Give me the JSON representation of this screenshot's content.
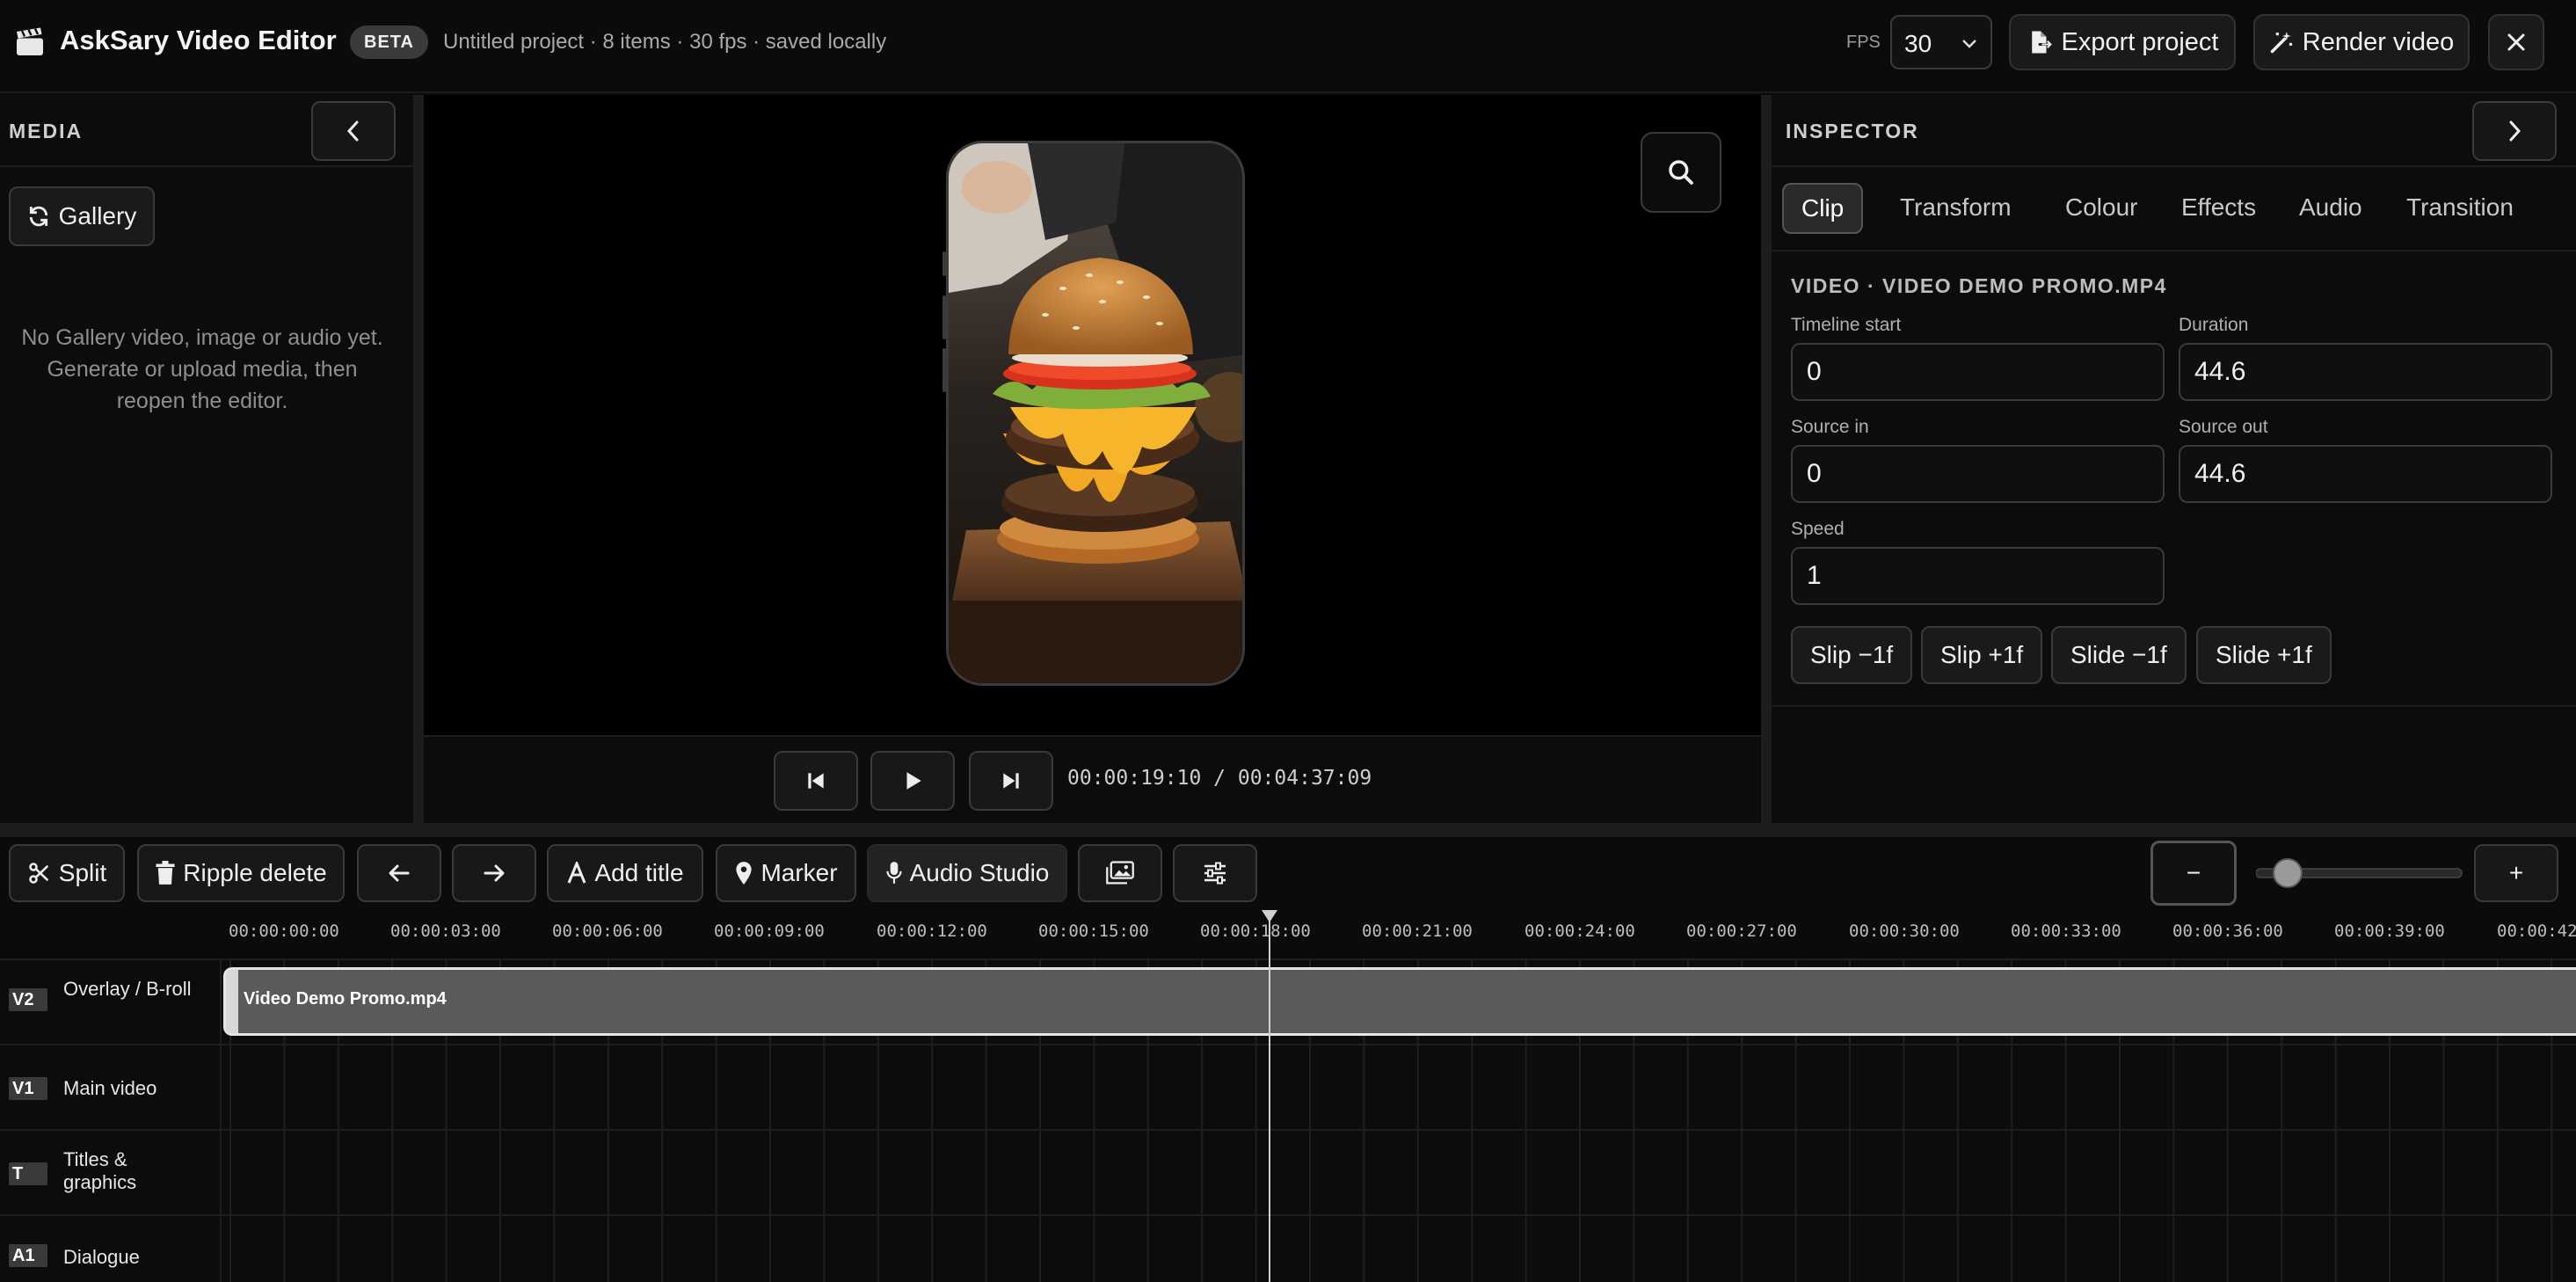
{
  "header": {
    "app_title": "AskSary Video Editor",
    "badge": "BETA",
    "project_meta": "Untitled project · 8 items · 30 fps · saved locally",
    "fps_label": "FPS",
    "fps_value": "30",
    "export_label": "Export project",
    "render_label": "Render video"
  },
  "media": {
    "title": "MEDIA",
    "gallery_label": "Gallery",
    "empty_line1": "No Gallery video, image or audio yet.",
    "empty_line2": "Generate or upload media, then reopen the editor."
  },
  "preview": {
    "timecode": "00:00:19:10 / 00:04:37:09"
  },
  "inspector": {
    "title": "INSPECTOR",
    "tabs": [
      "Clip",
      "Transform",
      "Colour",
      "Effects",
      "Audio",
      "Transition"
    ],
    "active_tab": "Clip",
    "clip_heading": "VIDEO · VIDEO DEMO PROMO.MP4",
    "fields": {
      "timeline_start_label": "Timeline start",
      "timeline_start_value": "0",
      "duration_label": "Duration",
      "duration_value": "44.6",
      "source_in_label": "Source in",
      "source_in_value": "0",
      "source_out_label": "Source out",
      "source_out_value": "44.6",
      "speed_label": "Speed",
      "speed_value": "1"
    },
    "actions": [
      "Slip −1f",
      "Slip +1f",
      "Slide −1f",
      "Slide +1f"
    ]
  },
  "toolbar": {
    "split": "Split",
    "ripple_delete": "Ripple delete",
    "add_title": "Add title",
    "marker": "Marker",
    "audio_studio": "Audio Studio",
    "zoom_out": "−",
    "zoom_in": "+"
  },
  "timeline": {
    "ruler": [
      "00:00:00:00",
      "00:00:03:00",
      "00:00:06:00",
      "00:00:09:00",
      "00:00:12:00",
      "00:00:15:00",
      "00:00:18:00",
      "00:00:21:00",
      "00:00:24:00",
      "00:00:27:00",
      "00:00:30:00",
      "00:00:33:00",
      "00:00:36:00",
      "00:00:39:00",
      "00:00:42"
    ],
    "tracks": [
      {
        "id": "V2",
        "name": "Overlay / B-roll"
      },
      {
        "id": "V1",
        "name": "Main video"
      },
      {
        "id": "T",
        "name": "Titles & graphics"
      },
      {
        "id": "A1",
        "name": "Dialogue"
      }
    ],
    "clip_label": "Video Demo Promo.mp4"
  }
}
